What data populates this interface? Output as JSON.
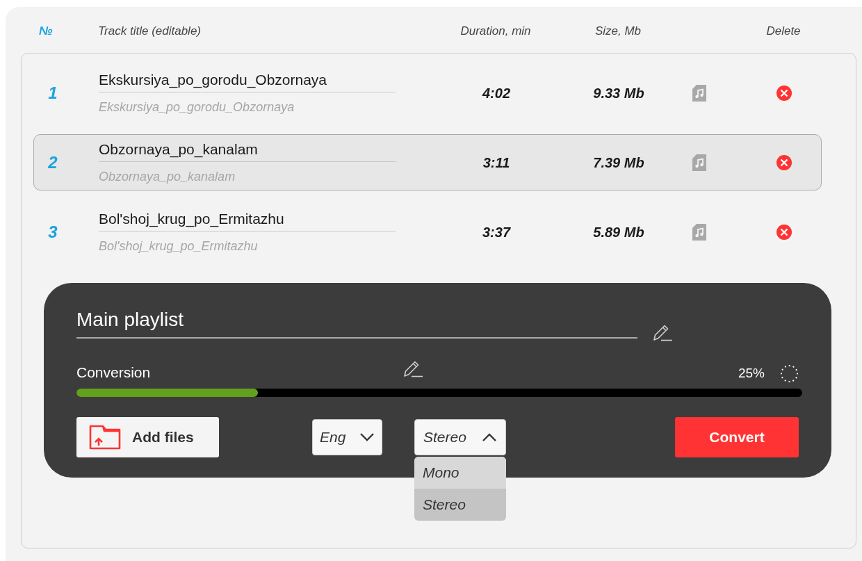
{
  "columns": [
    {
      "kind": "number",
      "label": "№"
    },
    {
      "kind": "title",
      "label": "Track title (editable)"
    },
    {
      "kind": "duration",
      "label": "Duration, min"
    },
    {
      "kind": "size",
      "label": "Size, Mb"
    },
    {
      "kind": "delete",
      "label": "Delete"
    }
  ],
  "tracks": [
    {
      "number": "1",
      "title": "Ekskursiya_po_gorodu_Obzornaya",
      "original": "Ekskursiya_po_gorodu_Obzornaya",
      "duration": "4:02",
      "size": "9.33 Mb",
      "selected": false
    },
    {
      "number": "2",
      "title": "Obzornaya_po_kanalam",
      "original": "Obzornaya_po_kanalam",
      "duration": "3:11",
      "size": "7.39 Mb",
      "selected": true
    },
    {
      "number": "3",
      "title": "Bol'shoj_krug_po_Ermitazhu",
      "original": "Bol'shoj_krug_po_Ermitazhu",
      "duration": "3:37",
      "size": "5.89 Mb",
      "selected": false
    }
  ],
  "playlist": {
    "name": "Main playlist",
    "conversion": {
      "label": "Conversion",
      "reading": "25%",
      "level": 0.25
    },
    "add_files": "Add files",
    "language": {
      "value": "Eng",
      "expanded": false
    },
    "channels": {
      "value": "Stereo",
      "expanded": true,
      "options": [
        {
          "label": "Mono",
          "selected": false
        },
        {
          "label": "Stereo",
          "selected": true
        }
      ]
    },
    "convert": "Convert"
  }
}
